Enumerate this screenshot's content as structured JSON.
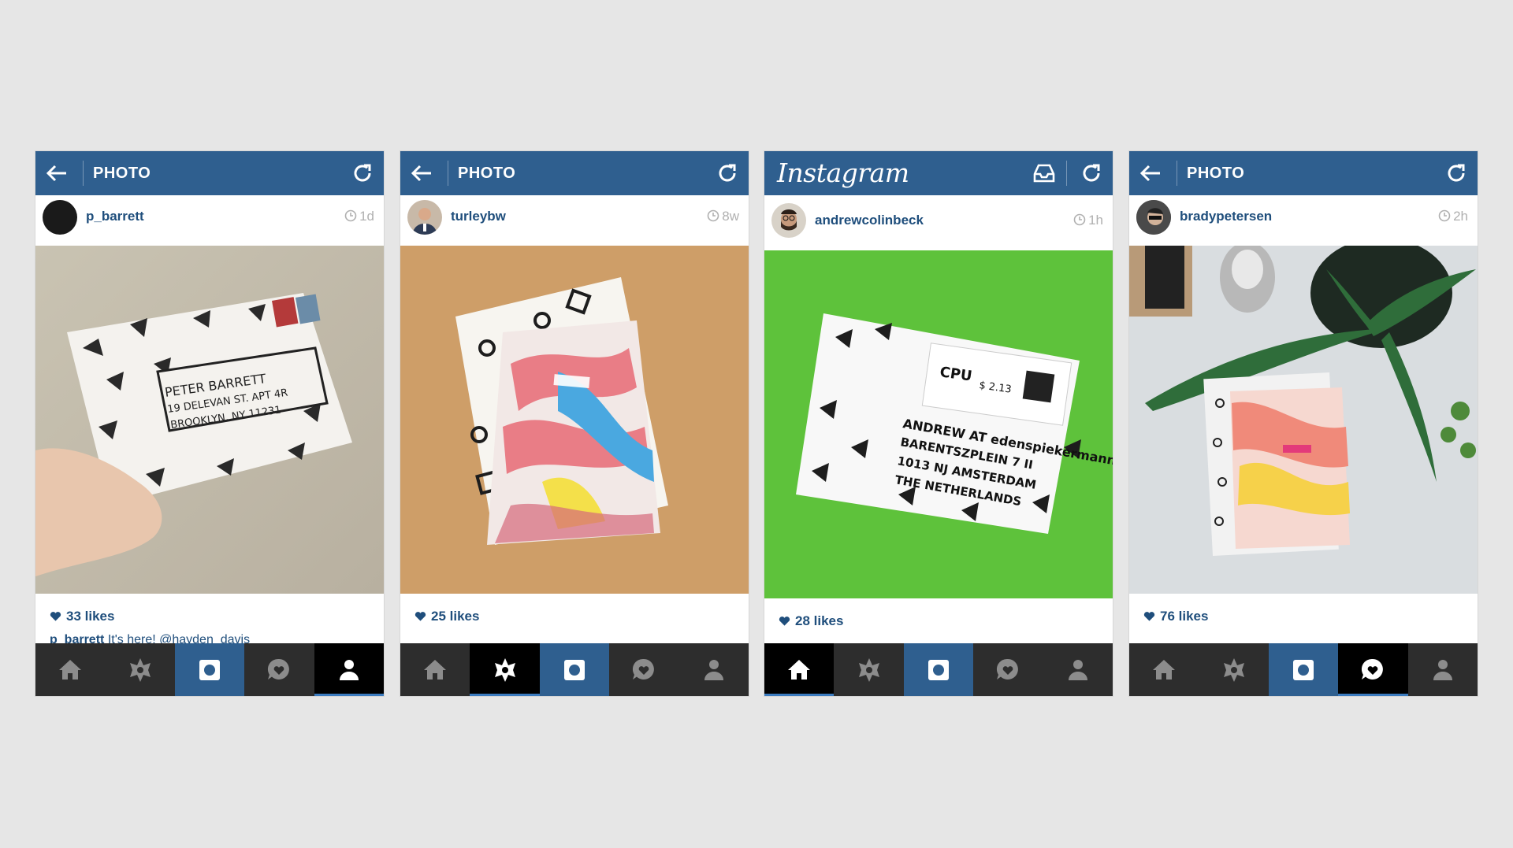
{
  "icons": {
    "back": "back-arrow-icon",
    "refresh": "refresh-icon",
    "inbox": "inbox-icon",
    "clock": "clock-icon",
    "heart": "heart-icon",
    "tabs": [
      "home-icon",
      "explore-icon",
      "camera-icon",
      "activity-icon",
      "profile-icon"
    ]
  },
  "colors": {
    "bar": "#2f5f8f",
    "text_blue": "#1f4e7c",
    "tab_bg": "#2d2d2d",
    "accent": "#3b7bbf"
  },
  "phones": [
    {
      "header": {
        "title": "PHOTO"
      },
      "post": {
        "username": "p_barrett",
        "time": "1d",
        "likes": "33 likes",
        "caption_user": "p_barrett",
        "caption_text": "It's here! @hayden_davis"
      },
      "active_tab": "profile"
    },
    {
      "header": {
        "title": "PHOTO"
      },
      "post": {
        "username": "turleybw",
        "time": "8w",
        "likes": "25 likes"
      },
      "active_tab": "explore"
    },
    {
      "header": {
        "logo": "Instagram"
      },
      "post": {
        "username": "andrewcolinbeck",
        "time": "1h",
        "likes": "28 likes"
      },
      "active_tab": "home"
    },
    {
      "header": {
        "title": "PHOTO"
      },
      "post": {
        "username": "bradypetersen",
        "time": "2h",
        "likes": "76 likes"
      },
      "active_tab": "activity"
    }
  ],
  "photo_text": {
    "envelope1": [
      "PETER BARRETT",
      "19 DELEVAN ST. APT 4R",
      "BROOKLYN, NY 11231"
    ],
    "envelope3": [
      "ANDREW AT edenspiekermann",
      "BARENTSZPLEIN 7 II",
      "1013 NJ AMSTERDAM",
      "THE NETHERLANDS"
    ],
    "stamp3": [
      "CPU",
      "$ 2.13"
    ]
  }
}
